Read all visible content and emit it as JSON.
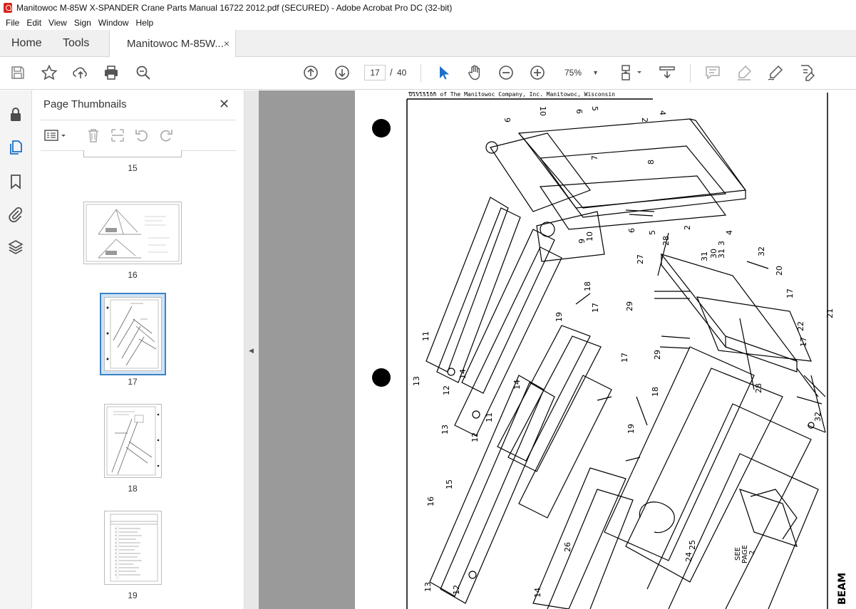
{
  "window": {
    "title": "Manitowoc M-85W X-SPANDER Crane Parts Manual 16722 2012.pdf (SECURED) - Adobe Acrobat Pro DC (32-bit)"
  },
  "menu": [
    "File",
    "Edit",
    "View",
    "Sign",
    "Window",
    "Help"
  ],
  "tabs": {
    "home": "Home",
    "tools": "Tools",
    "document": "Manitowoc M-85W...",
    "close": "×"
  },
  "toolbar": {
    "current_page": "17",
    "page_separator": "/",
    "total_pages": "40",
    "zoom": "75%",
    "icons": [
      "save-icon",
      "bookmark-star-icon",
      "upload-icon",
      "print-icon",
      "find-zoom-icon",
      "page-up-icon",
      "page-down-icon",
      "select-cursor-icon",
      "hand-icon",
      "zoom-out-icon",
      "zoom-in-icon",
      "page-display-icon",
      "scroll-mode-icon",
      "comment-icon",
      "highlight-icon",
      "sign-icon",
      "fill-sign-icon"
    ]
  },
  "left_rail": [
    "lock-icon",
    "page-thumbnails-icon",
    "bookmark-icon",
    "attachment-icon",
    "layers-icon"
  ],
  "panel": {
    "title": "Page Thumbnails",
    "close": "✕",
    "thumbnails": [
      {
        "label": "15"
      },
      {
        "label": "16"
      },
      {
        "label": "17",
        "selected": true
      },
      {
        "label": "18"
      },
      {
        "label": "19"
      }
    ]
  },
  "document_page": {
    "header_line": "Division of The Manitowoc Company, Inc.      Manitowoc, Wisconsin",
    "side_label": "BEAM",
    "see_page": [
      "SEE",
      "PAGE",
      "2"
    ],
    "callouts": [
      "9",
      "10",
      "6",
      "5",
      "2",
      "4",
      "8",
      "7",
      "6",
      "5",
      "2",
      "3",
      "4",
      "10",
      "9",
      "28",
      "27",
      "31",
      "30",
      "31",
      "32",
      "20",
      "18",
      "17",
      "29",
      "17",
      "21",
      "22",
      "17",
      "19",
      "11",
      "29",
      "13",
      "14",
      "12",
      "17",
      "28",
      "13",
      "12",
      "11",
      "14",
      "18",
      "19",
      "32",
      "15",
      "16",
      "26",
      "25",
      "24",
      "13",
      "12",
      "14"
    ]
  }
}
